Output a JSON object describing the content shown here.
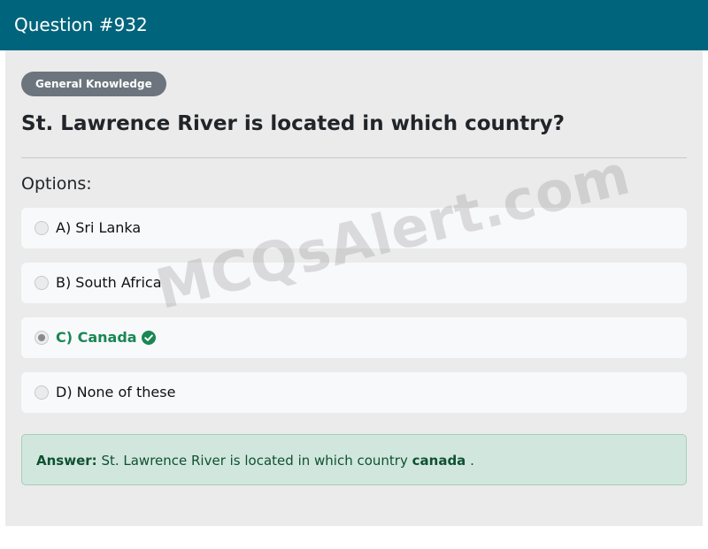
{
  "header": {
    "title": "Question #932"
  },
  "category_badge": "General Knowledge",
  "question_text": "St. Lawrence River is located in which country?",
  "options_label": "Options:",
  "options": [
    {
      "label": "A) Sri Lanka",
      "selected": false,
      "correct": false
    },
    {
      "label": "B) South Africa",
      "selected": false,
      "correct": false
    },
    {
      "label": "C) Canada",
      "selected": true,
      "correct": true,
      "icon": "check-circle-icon"
    },
    {
      "label": "D) None of these",
      "selected": false,
      "correct": false
    }
  ],
  "answer": {
    "key": "Answer:",
    "text": "St. Lawrence River is located in which country",
    "value": "canada",
    "suffix": "."
  },
  "watermark": "MCQsAlert.com",
  "colors": {
    "header_bg": "#00647c",
    "badge_bg": "#6c757d",
    "correct_green": "#198754",
    "answer_bg": "#d1e7dd"
  }
}
